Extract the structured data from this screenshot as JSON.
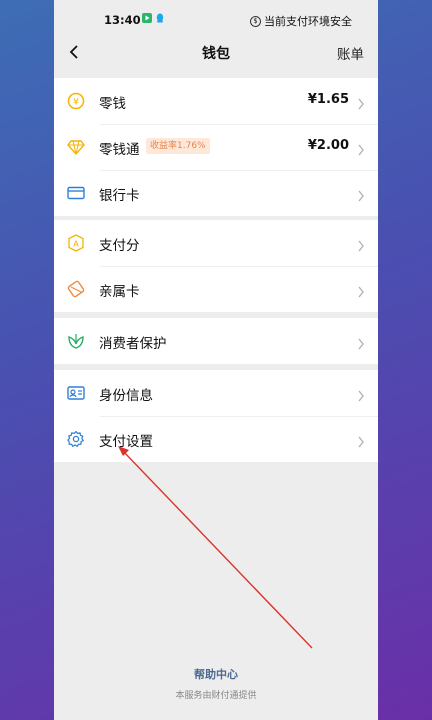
{
  "status_bar": {
    "time": "13:40",
    "security_text": "当前支付环境安全"
  },
  "nav": {
    "title": "钱包",
    "right_label": "账单"
  },
  "groups": [
    {
      "items": [
        {
          "label": "零钱",
          "value": "¥1.65",
          "icon": "coin-icon",
          "color": "#f4b400"
        },
        {
          "label": "零钱通",
          "badge": "收益率1.76%",
          "value": "¥2.00",
          "icon": "diamond-icon",
          "color": "#f4b400"
        },
        {
          "label": "银行卡",
          "icon": "bank-card-icon",
          "color": "#2f7fd6"
        }
      ]
    },
    {
      "items": [
        {
          "label": "支付分",
          "icon": "pay-score-icon",
          "color": "#f4b400"
        },
        {
          "label": "亲属卡",
          "icon": "family-card-icon",
          "color": "#f08a3c"
        }
      ]
    },
    {
      "items": [
        {
          "label": "消费者保护",
          "icon": "leaf-shield-icon",
          "color": "#2aae67"
        }
      ]
    },
    {
      "items": [
        {
          "label": "身份信息",
          "icon": "id-card-icon",
          "color": "#2f7fd6"
        },
        {
          "label": "支付设置",
          "icon": "gear-icon",
          "color": "#2f7fd6"
        }
      ]
    }
  ],
  "footer": {
    "help": "帮助中心",
    "note": "本服务由财付通提供"
  },
  "annotation": {
    "arrow_color": "#d9342b"
  }
}
